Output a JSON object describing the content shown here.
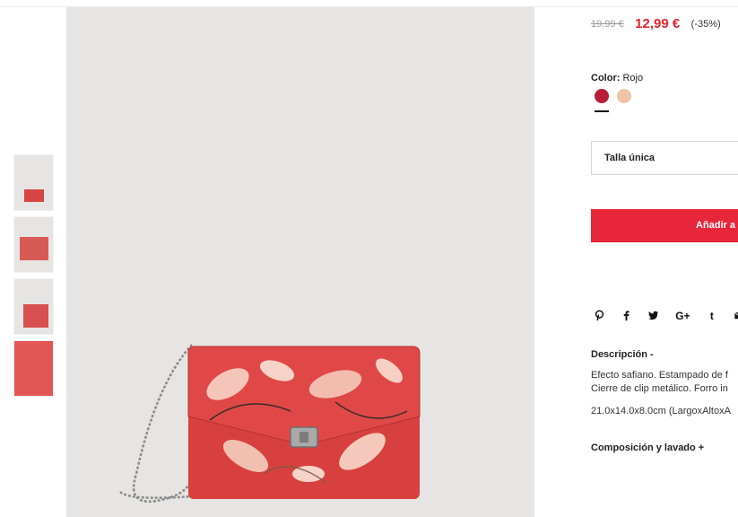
{
  "product": {
    "old_price": "19,99 €",
    "new_price": "12,99 €",
    "discount": "(-35%)"
  },
  "color": {
    "label": "Color:",
    "value": "Rojo",
    "swatches": [
      {
        "name": "Rojo",
        "hex": "#b81e35"
      },
      {
        "name": "beige",
        "hex": "#f0c4a2"
      }
    ]
  },
  "size": {
    "selected": "Talla única"
  },
  "cart": {
    "add_label": "Añadir a"
  },
  "share": {
    "icons": [
      "pinterest-icon",
      "facebook-icon",
      "twitter-icon",
      "google-plus-icon",
      "tumblr-icon",
      "email-icon"
    ],
    "google_plus_label": "G+",
    "tumblr_label": "t"
  },
  "description": {
    "title": "Descripción  -",
    "line1": "Efecto safiano. Estampado de f",
    "line2": "Cierre de clip metálico. Forro in",
    "line3": "21.0x14.0x8.0cm (LargoxAltoxA"
  },
  "composition": {
    "title": "Composición y lavado  +"
  },
  "colors": {
    "accent": "#e8263a",
    "price_red": "#e3232c",
    "background_image": "#e6e5e3"
  }
}
